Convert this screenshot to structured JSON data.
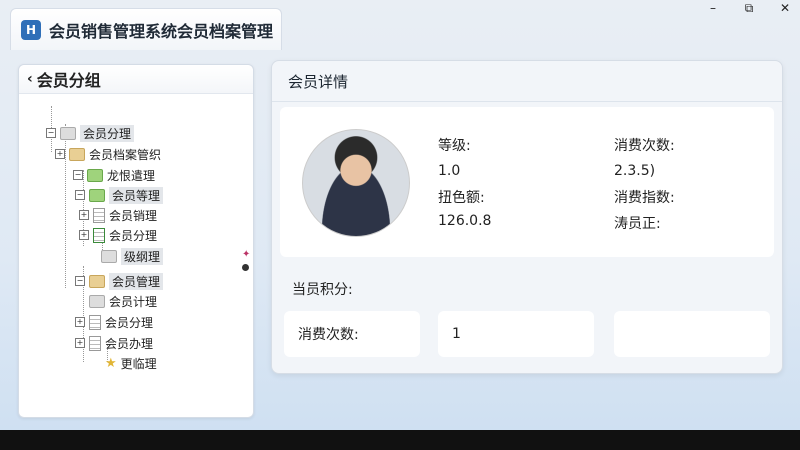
{
  "app": {
    "title": "会员销售管理系统会员档案管理",
    "icon": "app-logo-icon"
  },
  "window_controls": {
    "minimize": "–",
    "restore": "⧉",
    "close": "✕"
  },
  "sidebar": {
    "title": "会员分组",
    "nodes": [
      {
        "label": "会员分理",
        "icon": "folder-icon"
      },
      {
        "label": "会员档案管织",
        "icon": "folder-icon"
      },
      {
        "label": "龙恨遣理",
        "icon": "folder-icon"
      },
      {
        "label": "会员等理",
        "icon": "folder-icon"
      },
      {
        "label": "会员销理",
        "icon": "document-icon"
      },
      {
        "label": "会员分理",
        "icon": "document-icon"
      },
      {
        "label": "级纲理",
        "icon": "folder-icon"
      },
      {
        "label": "会员管理",
        "icon": "folder-icon"
      },
      {
        "label": "会员计理",
        "icon": "folder-icon"
      },
      {
        "label": "会员分理",
        "icon": "document-icon"
      },
      {
        "label": "会员办理",
        "icon": "document-icon"
      },
      {
        "label": "更临理",
        "icon": "star-icon"
      }
    ]
  },
  "detail": {
    "title": "会员详情",
    "fields": {
      "level_label": "等级:",
      "level_value": "1.0",
      "balance_label": "扭色额:",
      "balance_value": "126.0.8",
      "count_label": "消费次数:",
      "count_value": "2.3.5)",
      "index_label": "消费指数:",
      "member_label": "涛员正:"
    },
    "points_label": "当员积分:",
    "stats": {
      "count_label": "消费次数:",
      "count_value": "1",
      "empty": ""
    }
  }
}
